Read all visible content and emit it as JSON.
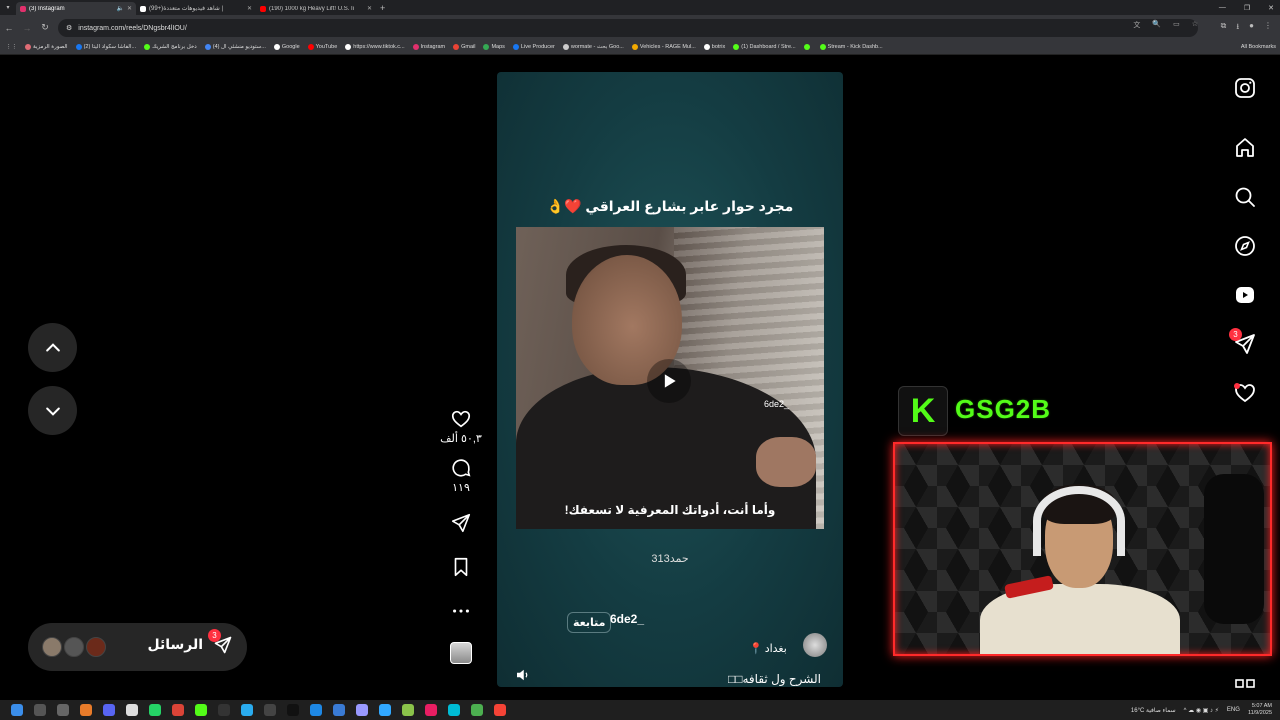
{
  "browser": {
    "tabs": [
      {
        "title": "(3) Instagram",
        "active": true,
        "favicon_color": "#e1306c"
      },
      {
        "title": "(99+)شاهد فيديوهات متعددة |",
        "active": false,
        "favicon_color": "#ffffff"
      },
      {
        "title": "(190) 1000 kg Heavy Lift! U.S. Ii",
        "active": false,
        "favicon_color": "#ff0000"
      }
    ],
    "url": "instagram.com/reels/DNgsbr4lIOU/",
    "bookmarks": [
      {
        "label": "الصورة الرمزية",
        "color": "#e06c75"
      },
      {
        "label": "(2) الفاشا سكواد اليتا...",
        "color": "#1877f2"
      },
      {
        "label": "دخل برنامج الشريك",
        "color": "#53fc18"
      },
      {
        "label": "(4) ستوديو منشئي ال...",
        "color": "#4285f4"
      },
      {
        "label": "Google",
        "color": "#ffffff"
      },
      {
        "label": "YouTube",
        "color": "#ff0000"
      },
      {
        "label": "https://www.tiktok.c...",
        "color": "#ffffff"
      },
      {
        "label": "Instagram",
        "color": "#e1306c"
      },
      {
        "label": "Gmail",
        "color": "#ea4335"
      },
      {
        "label": "Maps",
        "color": "#34a853"
      },
      {
        "label": "Live Producer",
        "color": "#1877f2"
      },
      {
        "label": "wormate - بحث Goo...",
        "color": "#cccccc"
      },
      {
        "label": "Vehicles - RAGE Mul...",
        "color": "#f2a900"
      },
      {
        "label": "botrix",
        "color": "#ffffff"
      },
      {
        "label": "(1) Dashboard / Stre...",
        "color": "#53fc18"
      },
      {
        "label": "",
        "color": "#53fc18"
      },
      {
        "label": "Stream - Kick Dashb...",
        "color": "#53fc18"
      }
    ],
    "all_bookmarks": "All Bookmarks"
  },
  "reel": {
    "title": "مجرد حوار عابر بشارع العراقي ❤️👌",
    "watermark": "6de2_",
    "subtitle": "وأما أنت، أدواتك المعرفية لا تسعفك!",
    "mid_caption": "حمد313",
    "username": "6de2_",
    "follow_label": "متابعة",
    "location": "بغداد",
    "caption": "الشرح ول ثقافه□□"
  },
  "actions": {
    "likes": "٥٠,٣ ألف",
    "comments": "١١٩"
  },
  "messages": {
    "label": "الرسائل",
    "badge": "3"
  },
  "nav": {
    "messages_badge": "3"
  },
  "stream": {
    "channel_name": "GSG2B",
    "kick_letter": "K",
    "accent": "#53fc18",
    "frame_color": "#ff2a2a"
  },
  "taskbar": {
    "weather": "16°C  سماء صافية",
    "lang": "ENG",
    "time": "5:07 AM",
    "date": "11/9/2025"
  }
}
